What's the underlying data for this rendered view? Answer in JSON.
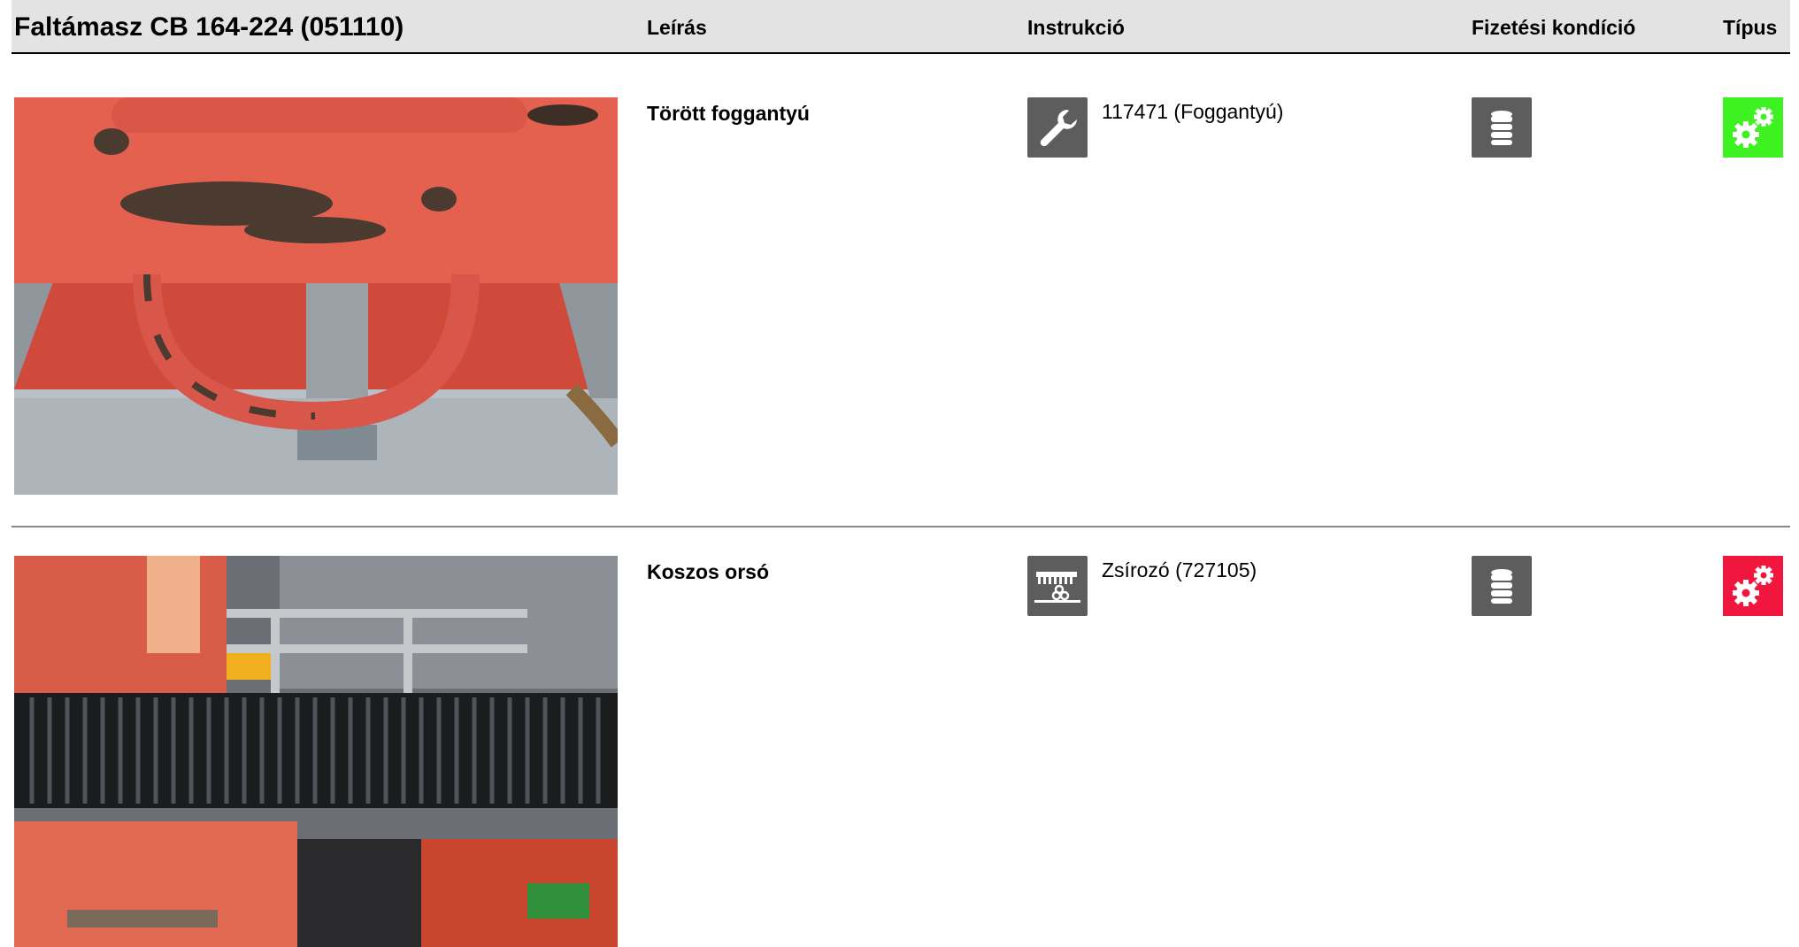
{
  "header": {
    "title": "Faltámasz CB 164-224 (051110)",
    "col_leiras": "Leírás",
    "col_instrukcio": "Instrukció",
    "col_fizetesi": "Fizetési kondíció",
    "col_tipus": "Típus"
  },
  "rows": [
    {
      "description": "Törött foggantyú",
      "instruction_icon": "wrench-icon",
      "instruction_text": "117471 (Foggantyú)",
      "payment_icon": "coin-stack-icon",
      "type_icon": "gears-icon",
      "type_color": "#3ef120"
    },
    {
      "description": "Koszos orsó",
      "instruction_icon": "grease-icon",
      "instruction_text": "Zsírozó (727105)",
      "payment_icon": "coin-stack-icon",
      "type_icon": "gears-icon",
      "type_color": "#f0163d"
    }
  ]
}
